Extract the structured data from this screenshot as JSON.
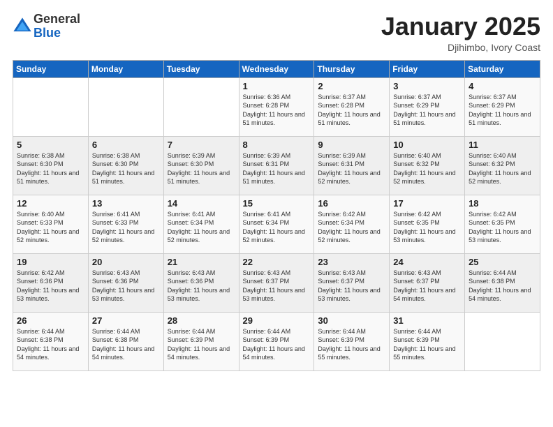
{
  "logo": {
    "general": "General",
    "blue": "Blue"
  },
  "title": "January 2025",
  "subtitle": "Djihimbo, Ivory Coast",
  "days_of_week": [
    "Sunday",
    "Monday",
    "Tuesday",
    "Wednesday",
    "Thursday",
    "Friday",
    "Saturday"
  ],
  "weeks": [
    [
      {
        "day": "",
        "info": ""
      },
      {
        "day": "",
        "info": ""
      },
      {
        "day": "",
        "info": ""
      },
      {
        "day": "1",
        "info": "Sunrise: 6:36 AM\nSunset: 6:28 PM\nDaylight: 11 hours and 51 minutes."
      },
      {
        "day": "2",
        "info": "Sunrise: 6:37 AM\nSunset: 6:28 PM\nDaylight: 11 hours and 51 minutes."
      },
      {
        "day": "3",
        "info": "Sunrise: 6:37 AM\nSunset: 6:29 PM\nDaylight: 11 hours and 51 minutes."
      },
      {
        "day": "4",
        "info": "Sunrise: 6:37 AM\nSunset: 6:29 PM\nDaylight: 11 hours and 51 minutes."
      }
    ],
    [
      {
        "day": "5",
        "info": "Sunrise: 6:38 AM\nSunset: 6:30 PM\nDaylight: 11 hours and 51 minutes."
      },
      {
        "day": "6",
        "info": "Sunrise: 6:38 AM\nSunset: 6:30 PM\nDaylight: 11 hours and 51 minutes."
      },
      {
        "day": "7",
        "info": "Sunrise: 6:39 AM\nSunset: 6:30 PM\nDaylight: 11 hours and 51 minutes."
      },
      {
        "day": "8",
        "info": "Sunrise: 6:39 AM\nSunset: 6:31 PM\nDaylight: 11 hours and 51 minutes."
      },
      {
        "day": "9",
        "info": "Sunrise: 6:39 AM\nSunset: 6:31 PM\nDaylight: 11 hours and 52 minutes."
      },
      {
        "day": "10",
        "info": "Sunrise: 6:40 AM\nSunset: 6:32 PM\nDaylight: 11 hours and 52 minutes."
      },
      {
        "day": "11",
        "info": "Sunrise: 6:40 AM\nSunset: 6:32 PM\nDaylight: 11 hours and 52 minutes."
      }
    ],
    [
      {
        "day": "12",
        "info": "Sunrise: 6:40 AM\nSunset: 6:33 PM\nDaylight: 11 hours and 52 minutes."
      },
      {
        "day": "13",
        "info": "Sunrise: 6:41 AM\nSunset: 6:33 PM\nDaylight: 11 hours and 52 minutes."
      },
      {
        "day": "14",
        "info": "Sunrise: 6:41 AM\nSunset: 6:34 PM\nDaylight: 11 hours and 52 minutes."
      },
      {
        "day": "15",
        "info": "Sunrise: 6:41 AM\nSunset: 6:34 PM\nDaylight: 11 hours and 52 minutes."
      },
      {
        "day": "16",
        "info": "Sunrise: 6:42 AM\nSunset: 6:34 PM\nDaylight: 11 hours and 52 minutes."
      },
      {
        "day": "17",
        "info": "Sunrise: 6:42 AM\nSunset: 6:35 PM\nDaylight: 11 hours and 53 minutes."
      },
      {
        "day": "18",
        "info": "Sunrise: 6:42 AM\nSunset: 6:35 PM\nDaylight: 11 hours and 53 minutes."
      }
    ],
    [
      {
        "day": "19",
        "info": "Sunrise: 6:42 AM\nSunset: 6:36 PM\nDaylight: 11 hours and 53 minutes."
      },
      {
        "day": "20",
        "info": "Sunrise: 6:43 AM\nSunset: 6:36 PM\nDaylight: 11 hours and 53 minutes."
      },
      {
        "day": "21",
        "info": "Sunrise: 6:43 AM\nSunset: 6:36 PM\nDaylight: 11 hours and 53 minutes."
      },
      {
        "day": "22",
        "info": "Sunrise: 6:43 AM\nSunset: 6:37 PM\nDaylight: 11 hours and 53 minutes."
      },
      {
        "day": "23",
        "info": "Sunrise: 6:43 AM\nSunset: 6:37 PM\nDaylight: 11 hours and 53 minutes."
      },
      {
        "day": "24",
        "info": "Sunrise: 6:43 AM\nSunset: 6:37 PM\nDaylight: 11 hours and 54 minutes."
      },
      {
        "day": "25",
        "info": "Sunrise: 6:44 AM\nSunset: 6:38 PM\nDaylight: 11 hours and 54 minutes."
      }
    ],
    [
      {
        "day": "26",
        "info": "Sunrise: 6:44 AM\nSunset: 6:38 PM\nDaylight: 11 hours and 54 minutes."
      },
      {
        "day": "27",
        "info": "Sunrise: 6:44 AM\nSunset: 6:38 PM\nDaylight: 11 hours and 54 minutes."
      },
      {
        "day": "28",
        "info": "Sunrise: 6:44 AM\nSunset: 6:39 PM\nDaylight: 11 hours and 54 minutes."
      },
      {
        "day": "29",
        "info": "Sunrise: 6:44 AM\nSunset: 6:39 PM\nDaylight: 11 hours and 54 minutes."
      },
      {
        "day": "30",
        "info": "Sunrise: 6:44 AM\nSunset: 6:39 PM\nDaylight: 11 hours and 55 minutes."
      },
      {
        "day": "31",
        "info": "Sunrise: 6:44 AM\nSunset: 6:39 PM\nDaylight: 11 hours and 55 minutes."
      },
      {
        "day": "",
        "info": ""
      }
    ]
  ]
}
